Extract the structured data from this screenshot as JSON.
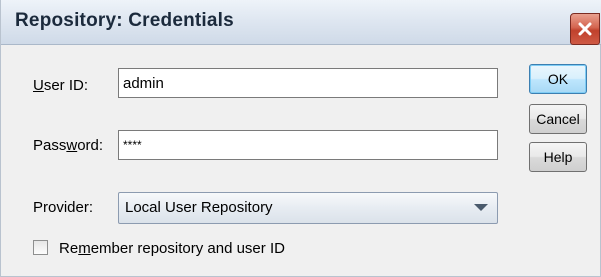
{
  "window": {
    "title": "Repository: Credentials",
    "close_icon": "close-icon",
    "accent_close": "#c7442f"
  },
  "form": {
    "user_id": {
      "label_pre": "",
      "label_mnemonic": "U",
      "label_post": "ser ID:",
      "value": "admin"
    },
    "password": {
      "label_pre": "Pass",
      "label_mnemonic": "w",
      "label_post": "ord:",
      "value": "****"
    },
    "provider": {
      "label": "Provider:",
      "selected": "Local User Repository",
      "arrow_icon": "chevron-down-icon"
    },
    "remember": {
      "label_pre": "Re",
      "label_mnemonic": "m",
      "label_post": "ember repository and user ID",
      "checked": false
    }
  },
  "buttons": {
    "ok": "OK",
    "cancel": "Cancel",
    "help": "Help"
  }
}
